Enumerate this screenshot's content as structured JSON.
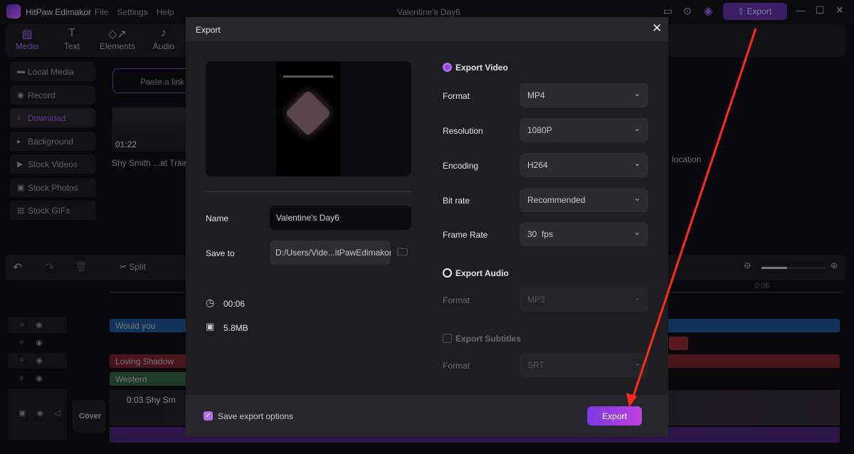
{
  "app": {
    "name": "HitPaw Edimakor",
    "menu": [
      "File",
      "Settings",
      "Help"
    ],
    "title": "Valentine's Day6",
    "export_label": "Export",
    "accent": "#8b3fd9"
  },
  "tabs": [
    {
      "label": "Media",
      "icon": "media-icon"
    },
    {
      "label": "Text",
      "icon": "text-icon"
    },
    {
      "label": "Elements",
      "icon": "elements-icon"
    },
    {
      "label": "Audio",
      "icon": "audio-icon"
    }
  ],
  "sidebar": [
    {
      "label": "Local Media"
    },
    {
      "label": "Record"
    },
    {
      "label": "Download"
    },
    {
      "label": "Background"
    },
    {
      "label": "Stock Videos"
    },
    {
      "label": "Stock Photos"
    },
    {
      "label": "Stock GIFs"
    }
  ],
  "media": {
    "paste_placeholder": "Paste a link",
    "clip_duration": "01:22",
    "clip_name": "Shy Smith ...at Traine",
    "location_text": "location"
  },
  "toolbar": {
    "split": "Split",
    "timecode": "0:05"
  },
  "timeline": {
    "tracks": [
      {
        "label": "Would you",
        "color": "#1a4a7a"
      },
      {
        "label": "Loving Shadow",
        "color": "#6a1e2a"
      },
      {
        "label": "Western",
        "color": "#2a4a35"
      }
    ],
    "video_clip": "0:03 Shy Sm",
    "cover": "Cover"
  },
  "dialog": {
    "title": "Export",
    "name_label": "Name",
    "name_value": "Valentine's Day6",
    "save_label": "Save to",
    "save_value": "D:/Users/Vide...itPawEdimakor",
    "duration": "00:06",
    "size": "5.8MB",
    "video": {
      "label": "Export Video",
      "selected": true,
      "fields": [
        {
          "label": "Format",
          "value": "MP4"
        },
        {
          "label": "Resolution",
          "value": "1080P"
        },
        {
          "label": "Encoding",
          "value": "H264"
        },
        {
          "label": "Bit rate",
          "value": "Recommended"
        },
        {
          "label": "Frame Rate",
          "value": "30  fps"
        }
      ]
    },
    "audio": {
      "label": "Export Audio",
      "selected": false,
      "format_label": "Format",
      "format_value": "MP3"
    },
    "subtitles": {
      "label": "Export Subtitles",
      "checked": false,
      "format_label": "Format",
      "format_value": "SRT"
    },
    "save_options": {
      "label": "Save export options",
      "checked": true
    },
    "export_button": "Export"
  }
}
